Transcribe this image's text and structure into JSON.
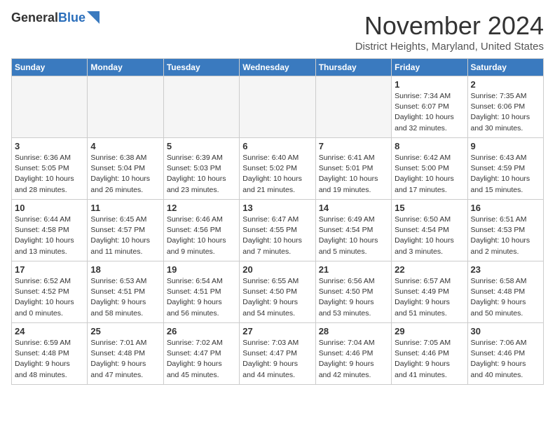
{
  "logo": {
    "line1": "General",
    "line2": "Blue"
  },
  "title": "November 2024",
  "location": "District Heights, Maryland, United States",
  "weekdays": [
    "Sunday",
    "Monday",
    "Tuesday",
    "Wednesday",
    "Thursday",
    "Friday",
    "Saturday"
  ],
  "weeks": [
    [
      {
        "day": "",
        "info": ""
      },
      {
        "day": "",
        "info": ""
      },
      {
        "day": "",
        "info": ""
      },
      {
        "day": "",
        "info": ""
      },
      {
        "day": "",
        "info": ""
      },
      {
        "day": "1",
        "info": "Sunrise: 7:34 AM\nSunset: 6:07 PM\nDaylight: 10 hours\nand 32 minutes."
      },
      {
        "day": "2",
        "info": "Sunrise: 7:35 AM\nSunset: 6:06 PM\nDaylight: 10 hours\nand 30 minutes."
      }
    ],
    [
      {
        "day": "3",
        "info": "Sunrise: 6:36 AM\nSunset: 5:05 PM\nDaylight: 10 hours\nand 28 minutes."
      },
      {
        "day": "4",
        "info": "Sunrise: 6:38 AM\nSunset: 5:04 PM\nDaylight: 10 hours\nand 26 minutes."
      },
      {
        "day": "5",
        "info": "Sunrise: 6:39 AM\nSunset: 5:03 PM\nDaylight: 10 hours\nand 23 minutes."
      },
      {
        "day": "6",
        "info": "Sunrise: 6:40 AM\nSunset: 5:02 PM\nDaylight: 10 hours\nand 21 minutes."
      },
      {
        "day": "7",
        "info": "Sunrise: 6:41 AM\nSunset: 5:01 PM\nDaylight: 10 hours\nand 19 minutes."
      },
      {
        "day": "8",
        "info": "Sunrise: 6:42 AM\nSunset: 5:00 PM\nDaylight: 10 hours\nand 17 minutes."
      },
      {
        "day": "9",
        "info": "Sunrise: 6:43 AM\nSunset: 4:59 PM\nDaylight: 10 hours\nand 15 minutes."
      }
    ],
    [
      {
        "day": "10",
        "info": "Sunrise: 6:44 AM\nSunset: 4:58 PM\nDaylight: 10 hours\nand 13 minutes."
      },
      {
        "day": "11",
        "info": "Sunrise: 6:45 AM\nSunset: 4:57 PM\nDaylight: 10 hours\nand 11 minutes."
      },
      {
        "day": "12",
        "info": "Sunrise: 6:46 AM\nSunset: 4:56 PM\nDaylight: 10 hours\nand 9 minutes."
      },
      {
        "day": "13",
        "info": "Sunrise: 6:47 AM\nSunset: 4:55 PM\nDaylight: 10 hours\nand 7 minutes."
      },
      {
        "day": "14",
        "info": "Sunrise: 6:49 AM\nSunset: 4:54 PM\nDaylight: 10 hours\nand 5 minutes."
      },
      {
        "day": "15",
        "info": "Sunrise: 6:50 AM\nSunset: 4:54 PM\nDaylight: 10 hours\nand 3 minutes."
      },
      {
        "day": "16",
        "info": "Sunrise: 6:51 AM\nSunset: 4:53 PM\nDaylight: 10 hours\nand 2 minutes."
      }
    ],
    [
      {
        "day": "17",
        "info": "Sunrise: 6:52 AM\nSunset: 4:52 PM\nDaylight: 10 hours\nand 0 minutes."
      },
      {
        "day": "18",
        "info": "Sunrise: 6:53 AM\nSunset: 4:51 PM\nDaylight: 9 hours\nand 58 minutes."
      },
      {
        "day": "19",
        "info": "Sunrise: 6:54 AM\nSunset: 4:51 PM\nDaylight: 9 hours\nand 56 minutes."
      },
      {
        "day": "20",
        "info": "Sunrise: 6:55 AM\nSunset: 4:50 PM\nDaylight: 9 hours\nand 54 minutes."
      },
      {
        "day": "21",
        "info": "Sunrise: 6:56 AM\nSunset: 4:50 PM\nDaylight: 9 hours\nand 53 minutes."
      },
      {
        "day": "22",
        "info": "Sunrise: 6:57 AM\nSunset: 4:49 PM\nDaylight: 9 hours\nand 51 minutes."
      },
      {
        "day": "23",
        "info": "Sunrise: 6:58 AM\nSunset: 4:48 PM\nDaylight: 9 hours\nand 50 minutes."
      }
    ],
    [
      {
        "day": "24",
        "info": "Sunrise: 6:59 AM\nSunset: 4:48 PM\nDaylight: 9 hours\nand 48 minutes."
      },
      {
        "day": "25",
        "info": "Sunrise: 7:01 AM\nSunset: 4:48 PM\nDaylight: 9 hours\nand 47 minutes."
      },
      {
        "day": "26",
        "info": "Sunrise: 7:02 AM\nSunset: 4:47 PM\nDaylight: 9 hours\nand 45 minutes."
      },
      {
        "day": "27",
        "info": "Sunrise: 7:03 AM\nSunset: 4:47 PM\nDaylight: 9 hours\nand 44 minutes."
      },
      {
        "day": "28",
        "info": "Sunrise: 7:04 AM\nSunset: 4:46 PM\nDaylight: 9 hours\nand 42 minutes."
      },
      {
        "day": "29",
        "info": "Sunrise: 7:05 AM\nSunset: 4:46 PM\nDaylight: 9 hours\nand 41 minutes."
      },
      {
        "day": "30",
        "info": "Sunrise: 7:06 AM\nSunset: 4:46 PM\nDaylight: 9 hours\nand 40 minutes."
      }
    ]
  ]
}
